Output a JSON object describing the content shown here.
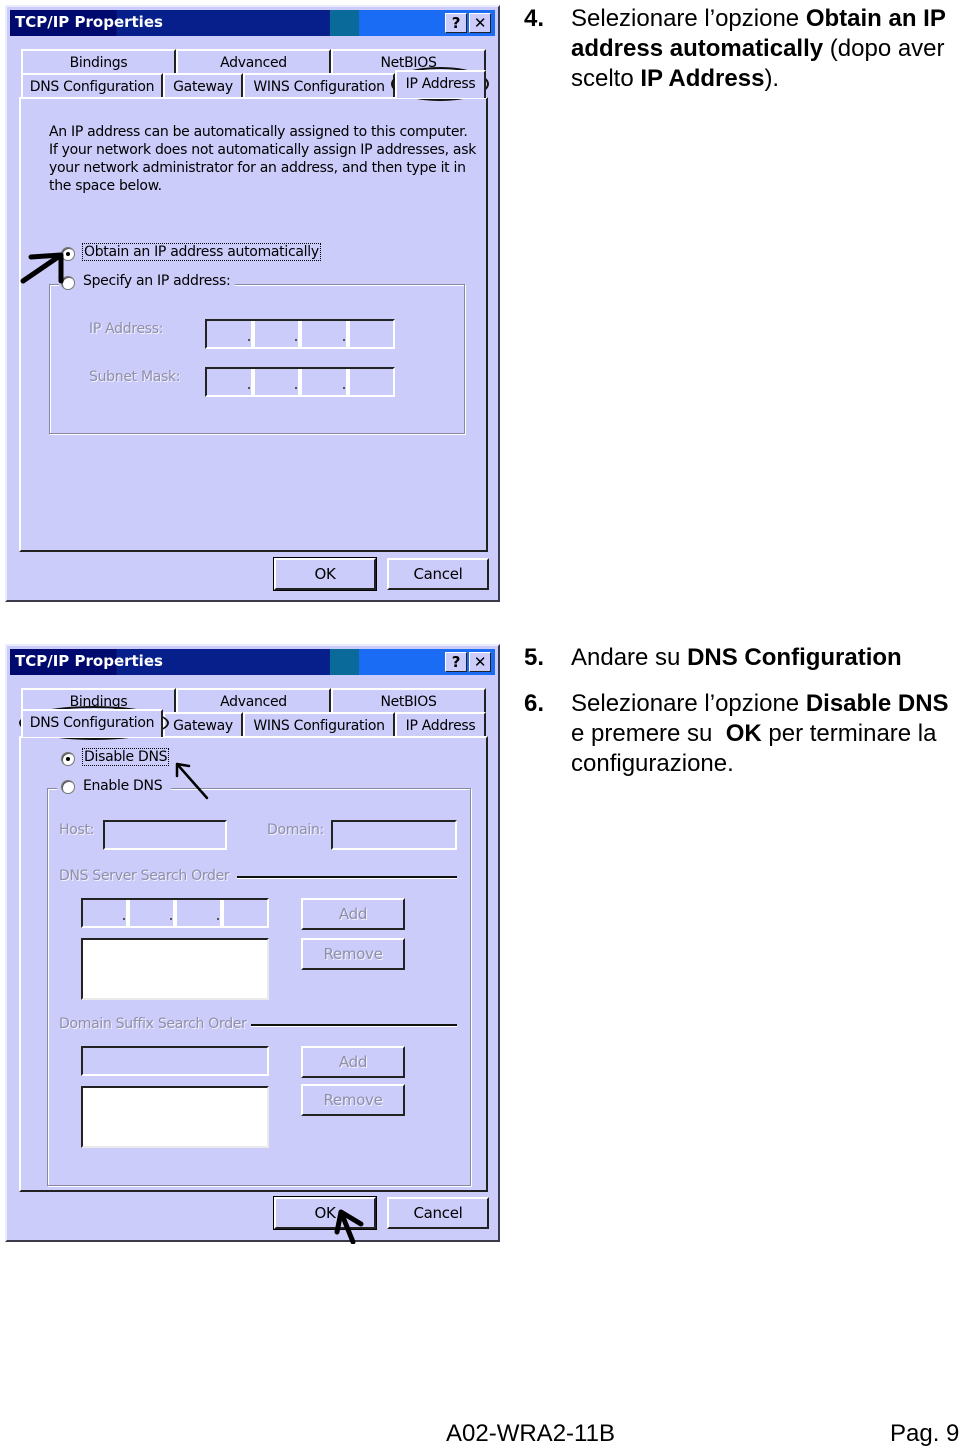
{
  "dialogs": [
    {
      "title": "TCP/IP Properties",
      "help_button": "?",
      "close_button": "✕",
      "tabs_back": [
        "Bindings",
        "Advanced",
        "NetBIOS"
      ],
      "tabs_front": [
        "DNS Configuration",
        "Gateway",
        "WINS Configuration",
        "IP Address"
      ],
      "active_tab": "IP Address",
      "description": [
        "An IP address can be automatically assigned to this computer.",
        "If your network does not automatically assign IP addresses, ask",
        "your network administrator for an address, and then type it in",
        "the space below."
      ],
      "radio_obtain": "Obtain an IP address automatically",
      "radio_obtain_checked": true,
      "radio_specify": "Specify an IP address:",
      "radio_specify_checked": false,
      "ip_address_label": "IP Address:",
      "ip_address_value": [
        "",
        "",
        "",
        ""
      ],
      "subnet_mask_label": "Subnet Mask:",
      "subnet_mask_value": [
        "",
        "",
        "",
        ""
      ],
      "ok_label": "OK",
      "cancel_label": "Cancel"
    },
    {
      "title": "TCP/IP Properties",
      "help_button": "?",
      "close_button": "✕",
      "tabs_back": [
        "Bindings",
        "Advanced",
        "NetBIOS"
      ],
      "tabs_front": [
        "DNS Configuration",
        "Gateway",
        "WINS Configuration",
        "IP Address"
      ],
      "active_tab": "DNS Configuration",
      "radio_disable": "Disable DNS",
      "radio_disable_checked": true,
      "radio_enable": "Enable DNS",
      "radio_enable_checked": false,
      "host_label": "Host:",
      "host_value": "",
      "domain_label": "Domain:",
      "domain_value": "",
      "dns_server_order_label": "DNS Server Search Order",
      "dns_server_input": [
        "",
        "",
        "",
        ""
      ],
      "dns_server_list": [],
      "add_label": "Add",
      "remove_label": "Remove",
      "domain_suffix_order_label": "Domain Suffix Search Order",
      "domain_suffix_input": "",
      "domain_suffix_list": [],
      "add2_label": "Add",
      "remove2_label": "Remove",
      "ok_label": "OK",
      "cancel_label": "Cancel"
    }
  ],
  "steps": [
    {
      "number": "4.",
      "parts": [
        {
          "text": "Selezionare l’opzione ",
          "bold": false
        },
        {
          "text": "Obtain an IP address automatically",
          "bold": true
        },
        {
          "text": " (dopo aver scelto ",
          "bold": false
        },
        {
          "text": "IP Address",
          "bold": true
        },
        {
          "text": ").",
          "bold": false
        }
      ]
    },
    {
      "number": "5.",
      "parts": [
        {
          "text": "Andare su ",
          "bold": false
        },
        {
          "text": "DNS Configuration",
          "bold": true
        }
      ]
    },
    {
      "number": "6.",
      "parts": [
        {
          "text": "Selezionare l’opzione ",
          "bold": false
        },
        {
          "text": "Disable DNS",
          "bold": true
        },
        {
          "text": " e premere su  ",
          "bold": false
        },
        {
          "text": "OK",
          "bold": true
        },
        {
          "text": " per terminare la configurazione.",
          "bold": false
        }
      ]
    }
  ],
  "footer": {
    "doc_code": "A02-WRA2-11B",
    "page": "Pag. 9"
  },
  "annotations": {
    "arrow_color": "#000000",
    "dialog_bg": "#ccccfa",
    "title_bar_dark": "#000a6e",
    "title_bar_light": "#1a6cf5"
  }
}
